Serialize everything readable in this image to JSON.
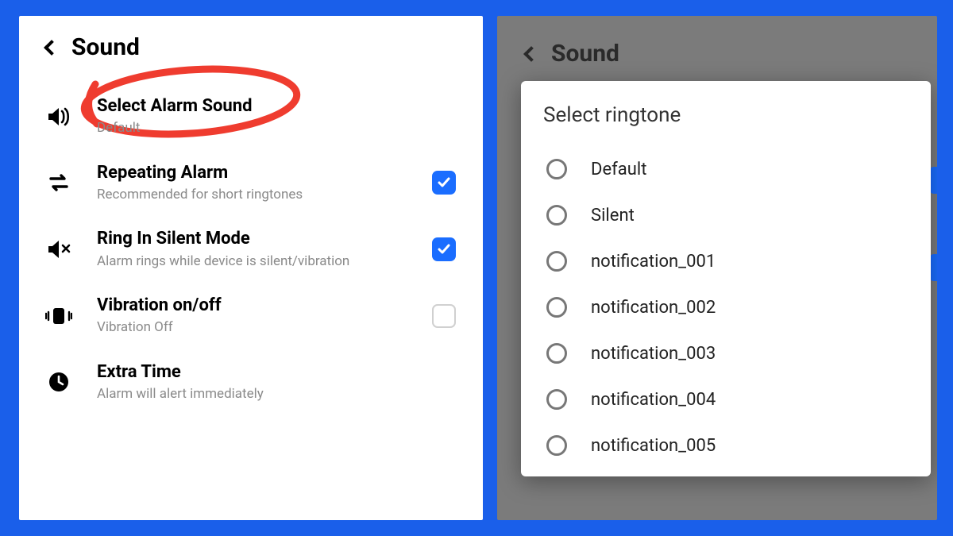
{
  "left": {
    "title": "Sound",
    "rows": [
      {
        "icon": "volume-icon",
        "title": "Select Alarm Sound",
        "sub": "Default"
      },
      {
        "icon": "repeat-icon",
        "title": "Repeating Alarm",
        "sub": "Recommended for short ringtones",
        "checked": true
      },
      {
        "icon": "mute-icon",
        "title": "Ring In Silent Mode",
        "sub": "Alarm rings while device is silent/vibration",
        "checked": true
      },
      {
        "icon": "vibrate-icon",
        "title": "Vibration on/off",
        "sub": "Vibration Off",
        "checked": false
      },
      {
        "icon": "clock-icon",
        "title": "Extra Time",
        "sub": "Alarm will alert immediately"
      }
    ]
  },
  "right": {
    "bg_title": "Sound",
    "dialog_title": "Select ringtone",
    "options": [
      "Default",
      "Silent",
      "notification_001",
      "notification_002",
      "notification_003",
      "notification_004",
      "notification_005"
    ]
  },
  "colors": {
    "accent": "#1a6dff",
    "annotation": "#ef3c2f"
  }
}
